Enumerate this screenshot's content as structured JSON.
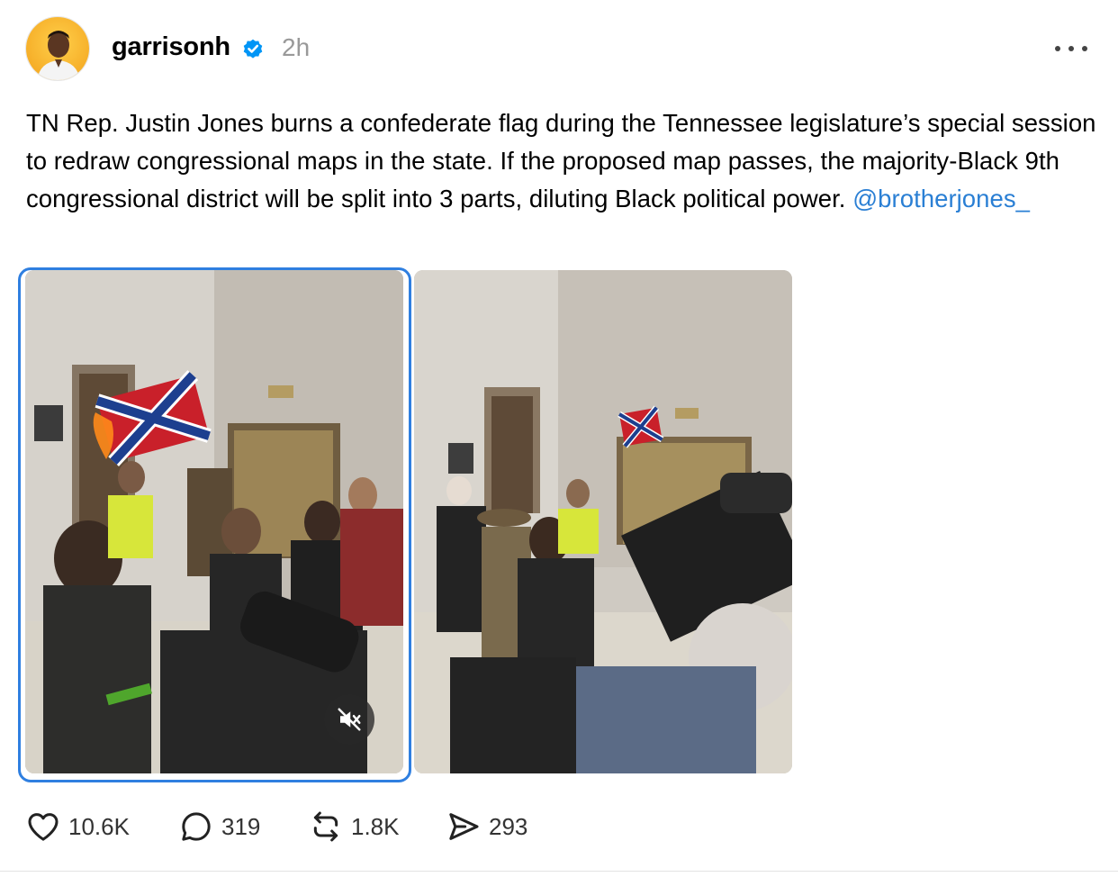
{
  "post": {
    "username": "garrisonh",
    "timestamp": "2h",
    "text": "TN Rep. Justin Jones burns a confederate flag during the Tennessee legislature’s special session to redraw congressional maps in the state. If the proposed map passes, the majority-Black 9th congressional district will be split into 3 parts, diluting Black political power.",
    "mention": "@brotherjones_",
    "verified_color": "#0095f6",
    "mention_color": "#2a7fd4"
  },
  "media": [
    {
      "name": "video",
      "selected": true,
      "muted": true
    },
    {
      "name": "photo",
      "selected": false
    }
  ],
  "icons": {
    "avatar": "avatar",
    "verified": "verified-badge-icon",
    "more": "more-options-icon",
    "mute": "speaker-muted-icon",
    "like": "heart-icon",
    "reply": "comment-icon",
    "repost": "repost-icon",
    "share": "send-icon"
  },
  "actions": {
    "likes": "10.6K",
    "replies": "319",
    "reposts": "1.8K",
    "shares": "293"
  }
}
